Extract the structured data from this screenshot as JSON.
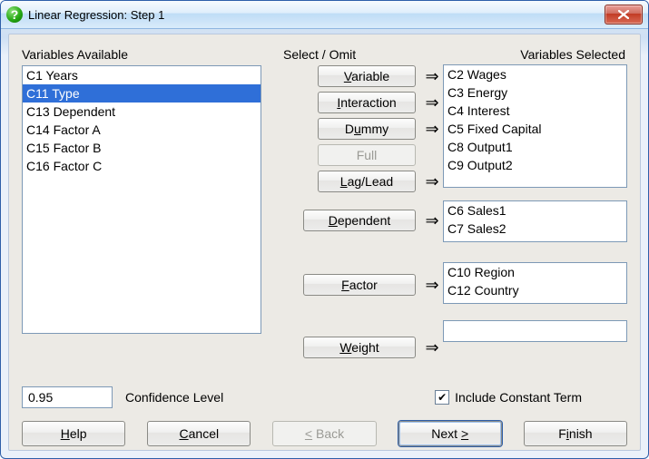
{
  "window": {
    "title": "Linear Regression: Step 1"
  },
  "labels": {
    "available": "Variables Available",
    "selectomit": "Select / Omit",
    "selected": "Variables Selected",
    "confidence": "Confidence Level",
    "include_constant": "Include Constant Term"
  },
  "buttons": {
    "variable": "Variable",
    "interaction": "Interaction",
    "dummy": "Dummy",
    "full": "Full",
    "laglead": "Lag/Lead",
    "dependent": "Dependent",
    "factor": "Factor",
    "weight": "Weight",
    "help": "Help",
    "cancel": "Cancel",
    "back": "< Back",
    "next": "Next >",
    "finish": "Finish"
  },
  "available_vars": [
    {
      "label": "C1 Years",
      "selected": false
    },
    {
      "label": "C11 Type",
      "selected": true
    },
    {
      "label": "C13 Dependent",
      "selected": false
    },
    {
      "label": "C14 Factor A",
      "selected": false
    },
    {
      "label": "C15 Factor B",
      "selected": false
    },
    {
      "label": "C16 Factor C",
      "selected": false
    }
  ],
  "selected_vars": [
    "C2 Wages",
    "C3 Energy",
    "C4 Interest",
    "C5 Fixed Capital",
    "C8 Output1",
    "C9 Output2"
  ],
  "dependent_vars": [
    "C6 Sales1",
    "C7 Sales2"
  ],
  "factor_vars": [
    "C10 Region",
    "C12 Country"
  ],
  "weight_value": "",
  "confidence_value": "0.95",
  "include_constant_checked": true,
  "arrow_glyph": "⇒",
  "check_glyph": "✔",
  "q_glyph": "?"
}
